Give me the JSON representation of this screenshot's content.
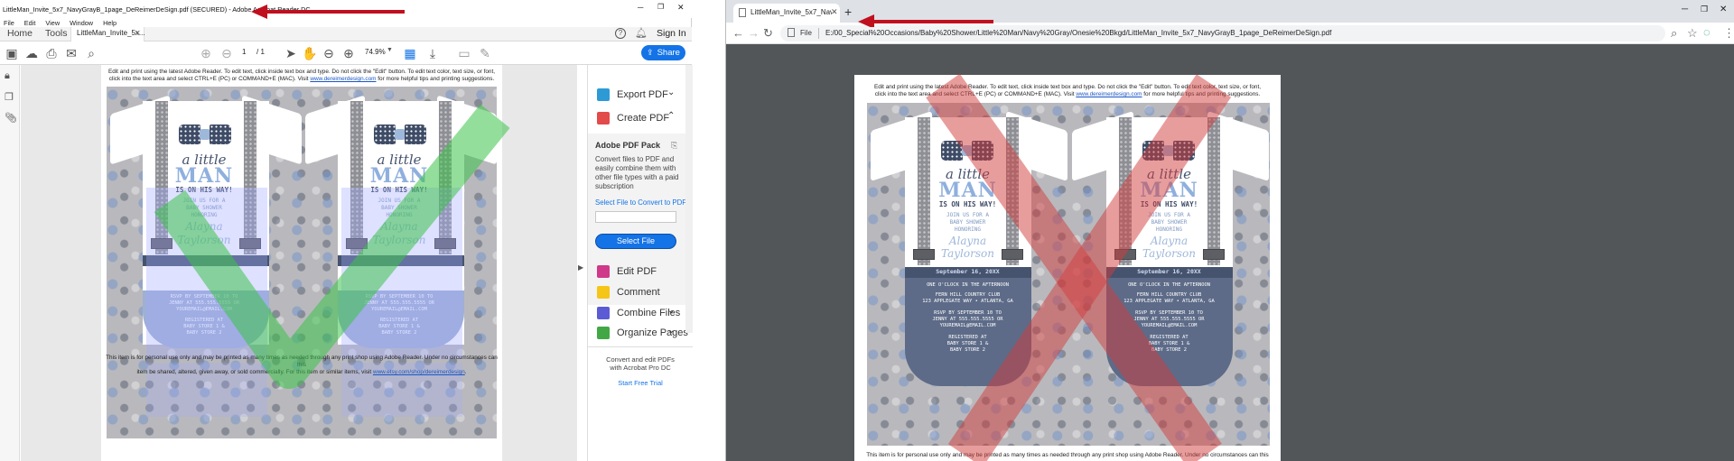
{
  "acrobat": {
    "title": "LittleMan_Invite_5x7_NavyGrayB_1page_DeReimerDeSign.pdf (SECURED) - Adobe Acrobat Reader DC",
    "menu": [
      "File",
      "Edit",
      "View",
      "Window",
      "Help"
    ],
    "tabs": {
      "home": "Home",
      "tools": "Tools",
      "doc": "LittleMan_Invite_5x..."
    },
    "sign_in": "Sign In",
    "page_current": "1",
    "page_total": "/ 1",
    "zoom": "74.9%",
    "share": "Share",
    "right_panel": {
      "export_pdf": "Export PDF",
      "create_pdf": "Create PDF",
      "pack_title": "Adobe PDF Pack",
      "pack_desc": "Convert files to PDF and easily combine them with other file types with a paid subscription",
      "select_file_label": "Select File to Convert to PDF",
      "select_file_button": "Select File",
      "edit_pdf": "Edit PDF",
      "comment": "Comment",
      "combine_files": "Combine Files",
      "organize_pages": "Organize Pages",
      "promo": "Convert and edit PDFs with Acrobat Pro DC",
      "trial": "Start Free Trial"
    }
  },
  "chrome": {
    "tab_title": "LittleMan_Invite_5x7_NavyGray1",
    "url_label": "File",
    "url": "E:/00_Special%20Occasions/Baby%20Shower/Little%20Man/Navy%20Gray/Onesie%20Bkgd/LittleMan_Invite_5x7_NavyGrayB_1page_DeReimerDeSign.pdf"
  },
  "document": {
    "instructions_1": "Edit and print using the latest Adobe Reader. To edit text, click inside text box and type. Do not click the \"Edit\" button. To edit text color, text size, or font,",
    "instructions_2a": "click into the text area and select CTRL+E (PC) or COMMAND+E (MAC). Visit",
    "instructions_link": "www.dereimerdesign.com",
    "instructions_2b": "for more helpful tips and printing suggestions.",
    "footer_1": "This item is for personal use only and may be printed as many times as needed through any print shop using Adobe Reader. Under no circumstances can this",
    "footer_2a": "item be shared, altered, given away, or sold commercially. For this item or similar items, visit",
    "footer_link": "www.etsy.com/shop/dereimerdesign",
    "footer_2b": ".",
    "footer_chrome": "This item is for personal use only and may be printed as many times as needed through any print shop using Adobe Reader. Under no circumstances can this",
    "invite": {
      "a_little": "a little",
      "man": "MAN",
      "on_way": "IS ON HIS WAY!",
      "join_1": "JOIN US FOR A",
      "join_2": "BABY SHOWER",
      "join_3": "HONORING",
      "name_1": "Alayna",
      "name_2": "Taylorson",
      "date": "September 16, 20XX",
      "time": "ONE O'CLOCK IN THE AFTERNOON",
      "venue_1": "FERN HILL COUNTRY CLUB",
      "venue_2": "123 APPLEGATE WAY • ATLANTA, GA",
      "rsvp_1": "RSVP BY SEPTEMBER 10 TO",
      "rsvp_2": "JENNY AT 555.555.5555 OR",
      "rsvp_3": "YOUREMAIL@EMAIL.COM",
      "reg_1": "REGISTERED AT",
      "reg_2": "BABY STORE 1 &",
      "reg_3": "BABY STORE 2"
    }
  },
  "colors": {
    "annotation_arrow": "#c0101e",
    "checkmark": "#3cc24a",
    "cross": "#d23c3c",
    "acrobat_blue": "#1473e6",
    "chrome_dark_bg": "#525659"
  }
}
